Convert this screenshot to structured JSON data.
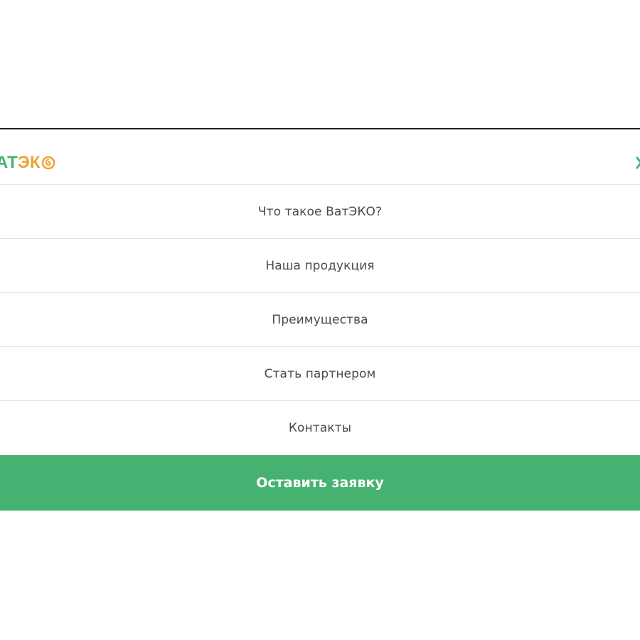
{
  "colors": {
    "green": "#46b271",
    "orange": "#eea23b",
    "text": "#4a4a4a",
    "cta_background": "#46b271",
    "cta_text": "#ffffff"
  },
  "header": {
    "logo": {
      "part_green": "АТ",
      "part_orange": "ЭК",
      "swirl_icon": "swirl-o-icon"
    },
    "close_icon": "close-x-icon"
  },
  "menu": {
    "items": [
      {
        "label": "Что такое ВатЭКО?"
      },
      {
        "label": "Наша продукция"
      },
      {
        "label": "Преимущества"
      },
      {
        "label": "Стать партнером"
      },
      {
        "label": "Контакты"
      }
    ]
  },
  "cta": {
    "label": "Оставить заявку"
  }
}
